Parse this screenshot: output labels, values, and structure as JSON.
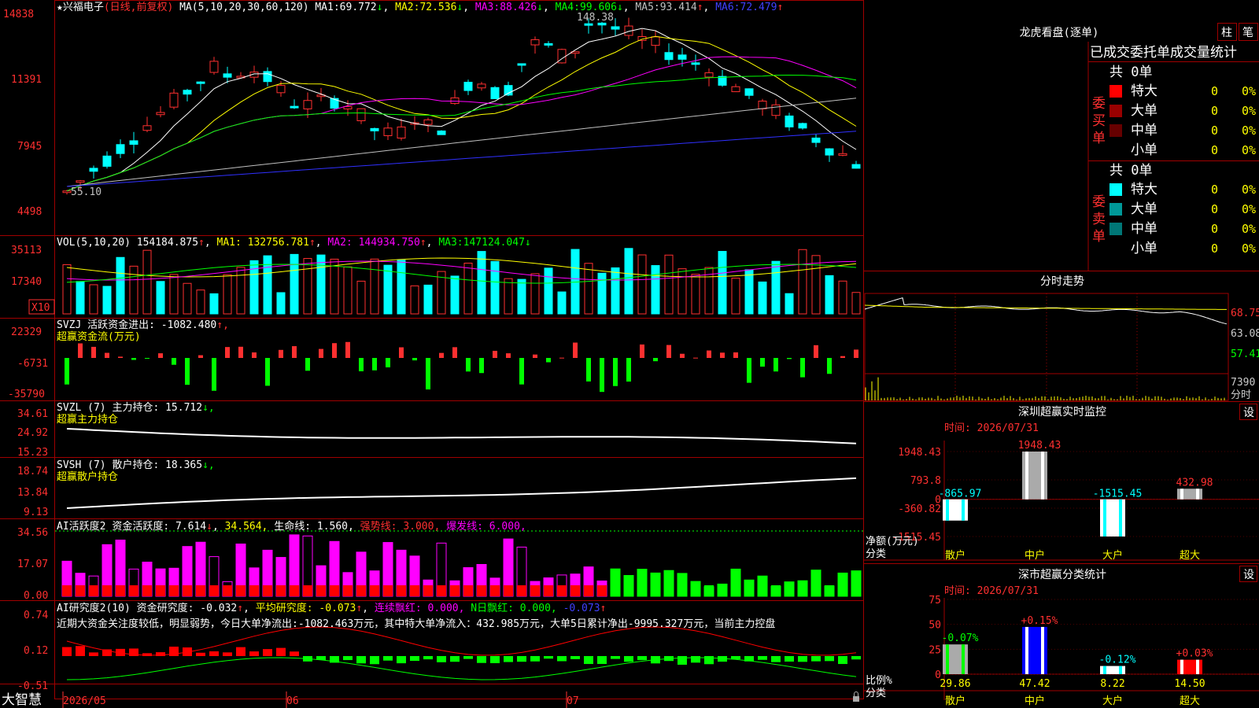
{
  "stock": {
    "name": "兴福电子",
    "mode": "(日线,前复权)",
    "ma_params": "MA(5,10,20,30,60,120)",
    "ma": [
      {
        "label": "MA1:",
        "value": "69.772",
        "arrow": "↓",
        "color": "#ffffff"
      },
      {
        "label": "MA2:",
        "value": "72.536",
        "arrow": "↓",
        "color": "#ffff00"
      },
      {
        "label": "MA3:",
        "value": "88.426",
        "arrow": "↓",
        "color": "#ff00ff"
      },
      {
        "label": "MA4:",
        "value": "99.606",
        "arrow": "↓",
        "color": "#00ff00"
      },
      {
        "label": "MA5:",
        "value": "93.414",
        "arrow": "↑",
        "color": "#c0c0c0"
      },
      {
        "label": "MA6:",
        "value": "72.479",
        "arrow": "↑",
        "color": "#3030ff"
      }
    ],
    "high_marker": "148.38",
    "low_marker": "55.10",
    "y_ticks": [
      "14838",
      "11391",
      "7945",
      "4498"
    ]
  },
  "vol": {
    "title": "VOL(5,10,20)",
    "value": "154184.875",
    "arrow": "↑",
    "ma": [
      {
        "label": "MA1:",
        "value": "132756.781",
        "arrow": "↑",
        "color": "#ffff00"
      },
      {
        "label": "MA2:",
        "value": "144934.750",
        "arrow": "↑",
        "color": "#ff00ff"
      },
      {
        "label": "MA3:",
        "value": "147124.047",
        "arrow": "↓",
        "color": "#00ff00"
      }
    ],
    "y_ticks": [
      "35113",
      "17340"
    ],
    "unit": "X10"
  },
  "svzj": {
    "title": "SVZJ",
    "label": "活跃资金进出:",
    "value": "-1082.480",
    "suffix": "↑,",
    "subtitle": "超赢资金流(万元)",
    "y_ticks": [
      "22329",
      "-6731",
      "-35790"
    ]
  },
  "svzl": {
    "title": "SVZL (7)",
    "label": "主力持仓:",
    "value": "15.712",
    "suffix": "↓,",
    "subtitle": "超赢主力持仓",
    "y_ticks": [
      "34.61",
      "24.92",
      "15.23"
    ]
  },
  "svsh": {
    "title": "SVSH (7)",
    "label": "散户持仓:",
    "value": "18.365",
    "suffix": "↓,",
    "subtitle": "超赢散户持仓",
    "y_ticks": [
      "18.74",
      "13.84",
      "9.13"
    ]
  },
  "ai_active": {
    "title": "AI活跃度2",
    "label": "资金活跃度:",
    "value": "7.614",
    "v2": "34.564,",
    "life_label": "生命线:",
    "life_value": "1.560,",
    "strong": "强势线: 3.000,",
    "burst": "爆发线: 6.000,",
    "y_ticks": [
      "34.56",
      "17.07",
      "0.00"
    ]
  },
  "ai_research": {
    "title": "AI研究度2(10)",
    "label": "资金研究度:",
    "value": "-0.032",
    "avg": "平均研究度: -0.073",
    "red": "连续飘红: 0.000,",
    "nred": "N日飘红: 0.000,",
    "last": "-0.073",
    "commentary": "近期大资金关注度较低，明显弱势，今日大单净流出:-1082.463万元，其中特大单净流入：432.985万元，大单5日累计净出-9995.327万元，当前主力控盘",
    "y_ticks": [
      "0.74",
      "0.12",
      "-0.51"
    ]
  },
  "x_labels": [
    "2026/05",
    "06",
    "07"
  ],
  "brand": "大智慧",
  "longhu": {
    "title": "龙虎看盘(逐单)",
    "btn1": "柱",
    "btn2": "笔",
    "subtitle": "已成交委托单成交量统计",
    "buy_side": "委买单",
    "sell_side": "委卖单",
    "buy_total": "共 0单",
    "sell_total": "共 0单",
    "buy_rows": [
      {
        "name": "特大",
        "count": "0",
        "pct": "0%",
        "color": "#ff0000"
      },
      {
        "name": "大单",
        "count": "0",
        "pct": "0%",
        "color": "#990000"
      },
      {
        "name": "中单",
        "count": "0",
        "pct": "0%",
        "color": "#660000"
      },
      {
        "name": "小单",
        "count": "0",
        "pct": "0%",
        "color": "#000000"
      }
    ],
    "sell_rows": [
      {
        "name": "特大",
        "count": "0",
        "pct": "0%",
        "color": "#00ffff"
      },
      {
        "name": "大单",
        "count": "0",
        "pct": "0%",
        "color": "#009999"
      },
      {
        "name": "中单",
        "count": "0",
        "pct": "0%",
        "color": "#007777"
      },
      {
        "name": "小单",
        "count": "0",
        "pct": "0%",
        "color": "#000000"
      }
    ]
  },
  "intraday": {
    "title": "分时走势",
    "price_ticks": [
      "68.75",
      "63.08",
      "57.41"
    ],
    "vol_tick": "7390",
    "unit": "分时"
  },
  "monitor": {
    "title": "深圳超赢实时监控",
    "settings": "设",
    "time": "时间: 2026/07/31",
    "y_ticks": [
      "1948.43",
      "793.8",
      "0",
      "-360.82",
      "-1515.45"
    ],
    "y_label": "净额(万元)",
    "x_label": "分类",
    "cats": [
      "散户",
      "中户",
      "大户",
      "超大"
    ],
    "values": [
      -865.97,
      1948.43,
      -1515.45,
      432.98
    ],
    "value_labels": [
      "-865.97",
      "1948.43",
      "-1515.45",
      "432.98"
    ]
  },
  "classify": {
    "title": "深市超赢分类统计",
    "settings": "设",
    "time": "时间: 2026/07/31",
    "y_ticks": [
      "75",
      "50",
      "25",
      "0"
    ],
    "y_label": "比例%",
    "x_label": "分类",
    "cats": [
      "散户",
      "中户",
      "大户",
      "超大"
    ],
    "values": [
      29.86,
      47.42,
      8.22,
      14.5
    ],
    "value_labels": [
      "29.86",
      "47.42",
      "8.22",
      "14.50"
    ],
    "change_labels": [
      "-0.07%",
      "+0.15%",
      "-0.12%",
      "+0.03%"
    ]
  },
  "chart_data": {
    "type": "bar",
    "title": "深圳超赢实时监控",
    "categories": [
      "散户",
      "中户",
      "大户",
      "超大"
    ],
    "series": [
      {
        "name": "净额(万元)",
        "values": [
          -865.97,
          1948.43,
          -1515.45,
          432.98
        ]
      },
      {
        "name": "比例%",
        "values": [
          29.86,
          47.42,
          8.22,
          14.5
        ]
      }
    ],
    "ylim": [
      -1515.45,
      1948.43
    ]
  }
}
